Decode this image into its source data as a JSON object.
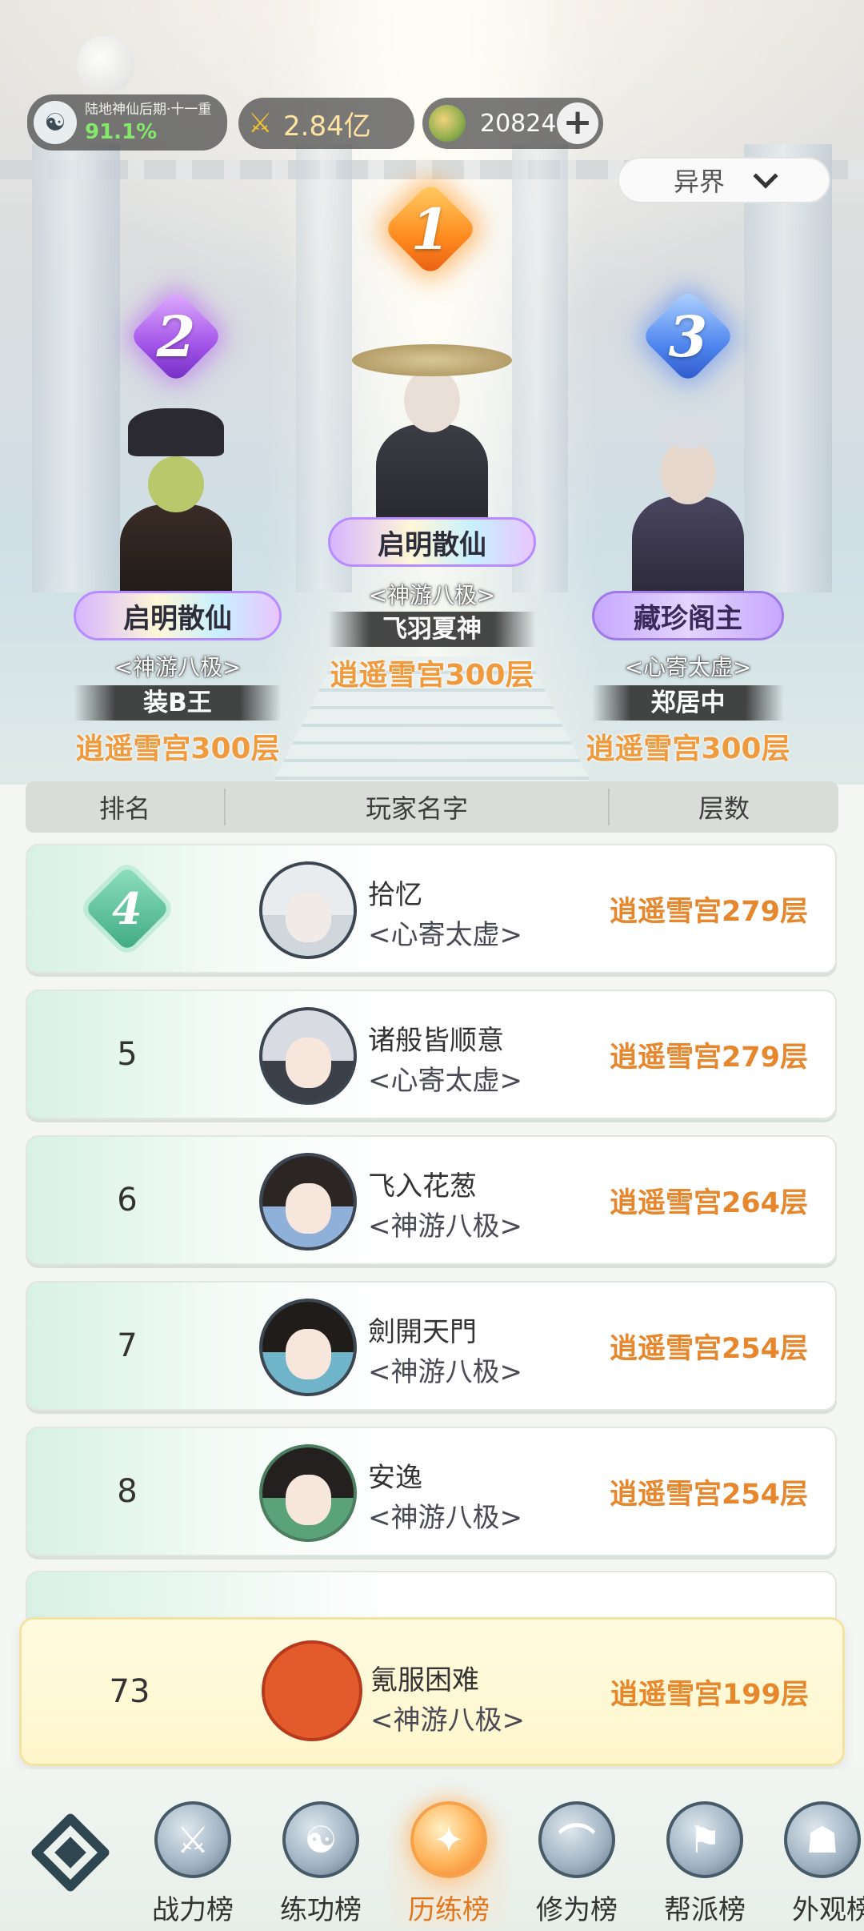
{
  "status_bar": {
    "realm_name": "陆地神仙后期·十一重",
    "realm_progress": "91.1%",
    "power": "2.84亿",
    "coins": "20824",
    "add_icon": "plus-icon"
  },
  "realm_filter": {
    "selected": "异界",
    "icon": "chevron-down-icon"
  },
  "podium": [
    {
      "rank": "1",
      "title": "启明散仙",
      "guild": "<神游八极>",
      "name": "飞羽夏神",
      "floor": "逍遥雪宫300层",
      "badge_color": "#ff8a1f"
    },
    {
      "rank": "2",
      "title": "启明散仙",
      "guild": "<神游八极>",
      "name": "装B王",
      "floor": "逍遥雪宫300层",
      "badge_color": "#a253e8"
    },
    {
      "rank": "3",
      "title": "藏珍阁主",
      "guild": "<心寄太虚>",
      "name": "郑居中",
      "floor": "逍遥雪宫300层",
      "badge_color": "#4f86ef"
    }
  ],
  "table_header": {
    "rank": "排名",
    "player": "玩家名字",
    "floor": "层数"
  },
  "rows": [
    {
      "rank": "4",
      "name": "拾忆",
      "guild": "<心寄太虚>",
      "floor": "逍遥雪宫279层"
    },
    {
      "rank": "5",
      "name": "诸般皆顺意",
      "guild": "<心寄太虚>",
      "floor": "逍遥雪宫279层"
    },
    {
      "rank": "6",
      "name": "飞入花葱",
      "guild": "<神游八极>",
      "floor": "逍遥雪宫264层"
    },
    {
      "rank": "7",
      "name": "劍開天門",
      "guild": "<神游八极>",
      "floor": "逍遥雪宫254层"
    },
    {
      "rank": "8",
      "name": "安逸",
      "guild": "<神游八极>",
      "floor": "逍遥雪宫254层"
    }
  ],
  "my_row": {
    "rank": "73",
    "name": "氪服困难",
    "guild": "<神游八极>",
    "floor": "逍遥雪宫199层"
  },
  "bottom_nav": {
    "items": [
      {
        "label": "战力榜",
        "icon": "sword-icon"
      },
      {
        "label": "练功榜",
        "icon": "yin-yang-icon"
      },
      {
        "label": "历练榜",
        "icon": "star-compass-icon",
        "active": true
      },
      {
        "label": "修为榜",
        "icon": "hat-icon"
      },
      {
        "label": "帮派榜",
        "icon": "banner-icon"
      },
      {
        "label": "外观榜",
        "icon": "mask-icon"
      }
    ]
  }
}
